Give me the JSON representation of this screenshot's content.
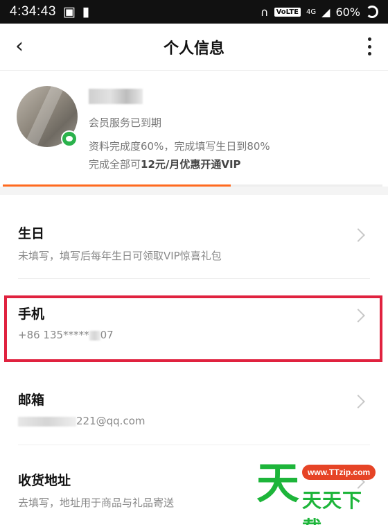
{
  "status_bar": {
    "time": "4:34:43",
    "volte": "VoLTE",
    "network": "4G",
    "battery": "60%"
  },
  "app_bar": {
    "title": "个人信息"
  },
  "profile": {
    "membership_status": "会员服务已到期",
    "completion_text": "资料完成度60%，完成填写生日到80%",
    "promo_prefix": "完成全部可",
    "promo_bold": "12元/月优惠开通VIP",
    "completion_percent": 60
  },
  "rows": [
    {
      "label": "生日",
      "sub": "未填写，填写后每年生日可领取VIP惊喜礼包"
    },
    {
      "label": "手机",
      "sub_prefix": "+86 135",
      "sub_mask": "*****",
      "sub_suffix": "07"
    },
    {
      "label": "邮箱",
      "sub_suffix": "221@qq.com"
    },
    {
      "label": "收货地址",
      "sub": "去填写，地址用于商品与礼品寄送"
    }
  ],
  "watermark": {
    "big": "天",
    "url": "www.TTzip.com",
    "text": "天天下载"
  },
  "colors": {
    "accent_orange": "#ff6a1f",
    "highlight_red": "#e0223f",
    "wechat_green": "#2bb24c",
    "watermark_green": "#1db53a"
  }
}
